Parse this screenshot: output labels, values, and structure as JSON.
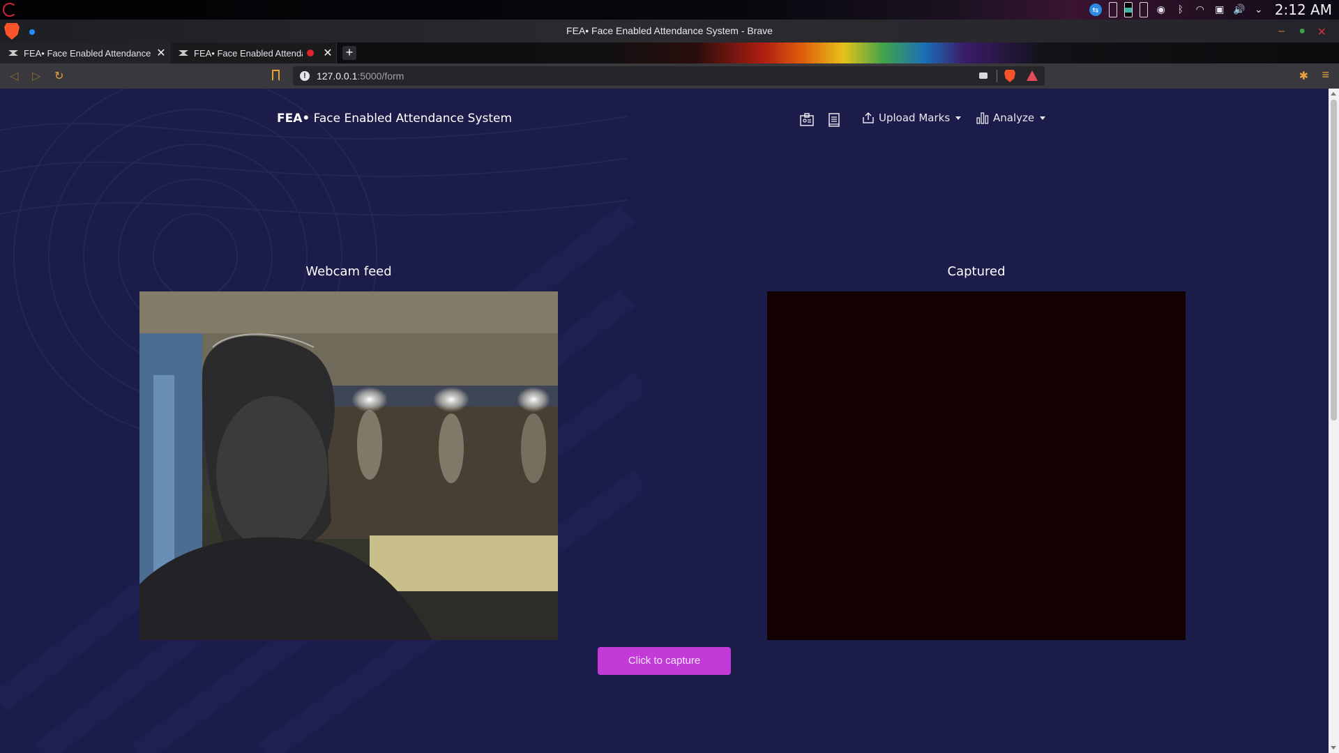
{
  "os": {
    "clock": "2:12 AM",
    "tray_icons": [
      "teamviewer-icon",
      "battery-icon",
      "battery-icon",
      "battery-icon",
      "accessibility-icon",
      "bluetooth-icon",
      "wifi-icon",
      "display-icon",
      "volume-icon",
      "chevron-down-icon"
    ]
  },
  "browser": {
    "window_title": "FEA• Face Enabled Attendance System - Brave",
    "tabs": [
      {
        "label": "FEA• Face Enabled Attendance System",
        "recording": false,
        "active": true
      },
      {
        "label": "FEA• Face Enabled Attendance System",
        "recording": true,
        "active": false
      }
    ],
    "new_tab_label": "+",
    "url": {
      "host": "127.0.0.1",
      "path": ":5000/form"
    }
  },
  "app": {
    "brand_bold": "FEA•",
    "brand_rest": " Face Enabled Attendance System",
    "nav": {
      "upload_marks": "Upload Marks",
      "analyze": "Analyze"
    },
    "webcam_title": "Webcam feed",
    "captured_title": "Captured",
    "capture_button": "Click to capture"
  },
  "colors": {
    "page_bg": "#1c1c4a",
    "accent_button": "#c23ad8",
    "captured_bg": "#130000"
  }
}
